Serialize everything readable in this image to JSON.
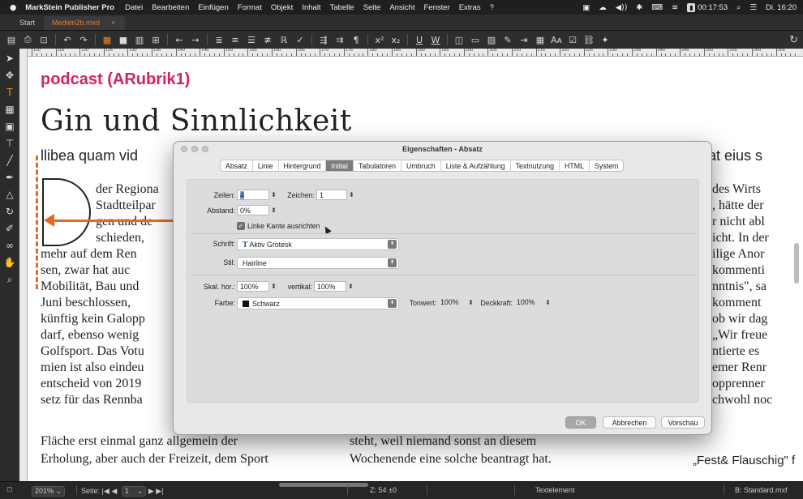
{
  "menubar": {
    "apple": "",
    "app_name": "MarkStein Publisher Pro",
    "items": [
      "Datei",
      "Bearbeiten",
      "Einfügen",
      "Format",
      "Objekt",
      "Inhalt",
      "Tabelle",
      "Seite",
      "Ansicht",
      "Fenster",
      "Extras",
      "?"
    ],
    "battery": "00:17:53",
    "datetime": "Di. 16:20"
  },
  "tabs": [
    {
      "label": "Start",
      "active": false
    },
    {
      "label": "Medien2b.mxd",
      "active": true,
      "close": "×"
    }
  ],
  "toolbar": {
    "icons": [
      "page-icon",
      "print-icon",
      "fit-icon",
      "undo-icon",
      "redo-icon",
      "frame-icon",
      "box-icon",
      "columns-icon",
      "grid-icon",
      "back-icon",
      "forward-icon",
      "align-left-icon",
      "align-center-icon",
      "align-right-icon",
      "justify-icon",
      "kerning-icon",
      "spellcheck-icon",
      "text-flow-icon",
      "text-wrap-icon",
      "paragraph-icon",
      "superscript-icon",
      "subscript-icon",
      "underline-icon",
      "word-underline-icon",
      "table-icon",
      "comment-icon",
      "image-icon",
      "style-icon",
      "tab-icon",
      "list-icon",
      "font-size-icon",
      "check-icon",
      "link-icon",
      "magic-icon"
    ],
    "superscript": "x²",
    "subscript": "x₂",
    "underline": "U",
    "word_underline": "W"
  },
  "ruler": {
    "labels": [
      "110",
      "115",
      "120",
      "125",
      "130",
      "135",
      "140",
      "145",
      "150",
      "155",
      "160",
      "165",
      "170",
      "175",
      "180",
      "185",
      "190",
      "195",
      "200",
      "205",
      "210",
      "215",
      "220",
      "225",
      "230",
      "235",
      "240",
      "245",
      "250",
      "255",
      "260",
      "265"
    ]
  },
  "document": {
    "rubrik": "podcast (ARubrik1)",
    "headline": "Gin und Sinnlichkeit",
    "lead_left": "llibea quam vid",
    "lead_right": "at eius s",
    "left_col": [
      "der Regiona",
      "Stadtteilpar",
      "gen und de",
      "schieden,",
      "mehr auf dem Ren",
      "sen, zwar hat auc",
      "Mobilität, Bau und",
      "Juni beschlossen,",
      "künftig kein Galopp",
      "darf, ebenso wenig",
      "Golfsport. Das Votu",
      "mien ist also eindeu",
      "entscheid von 2019",
      "setz für das Rennba",
      "Fläche erst einmal ganz allgemein der",
      "Erholung, aber auch der Freizeit, dem Sport"
    ],
    "mid_col": [
      "steht, weil niemand sonst an diesem",
      "Wochenende eine solche beantragt hat."
    ],
    "right_col": [
      "des Wirts",
      ", hätte der",
      "r nicht abl",
      "icht. In der",
      "ilige Anor",
      "kommenti",
      "nntnis\", sa",
      "komment",
      "ob wir dag",
      "„Wir freue",
      "ntierte es",
      "emer Renr",
      "opprenner",
      "chwohl noc",
      "",
      "„Fest& Flauschig\" f"
    ]
  },
  "dialog": {
    "title": "Eigenschaften - Absatz",
    "tabs": [
      "Absatz",
      "Linie",
      "Hintergrund",
      "Initial",
      "Tabulatoren",
      "Umbruch",
      "Liste & Aufzählung",
      "Textnutzung",
      "HTML",
      "System"
    ],
    "active_tab": "Initial",
    "zeilen_label": "Zeilen:",
    "zeilen_value": "4",
    "zeichen_label": "Zeichen:",
    "zeichen_value": "1",
    "abstand_label": "Abstand:",
    "abstand_value": "0%",
    "linke_kante_label": "Linke Kante ausrichten",
    "linke_kante_checked": true,
    "schrift_label": "Schrift:",
    "schrift_value": "Aktiv Grotesk",
    "stil_label": "Stil:",
    "stil_value": "Hairline",
    "skal_hor_label": "Skal. hor.:",
    "skal_hor_value": "100%",
    "vertikal_label": "vertikal:",
    "vertikal_value": "100%",
    "farbe_label": "Farbe:",
    "farbe_value": "Schwarz",
    "tonwert_label": "Tonwert:",
    "tonwert_value": "100%",
    "deckkraft_label": "Deckkraft:",
    "deckkraft_value": "100%",
    "ok_label": "OK",
    "cancel_label": "Abbrechen",
    "preview_label": "Vorschau"
  },
  "statusbar": {
    "zoom": "201%",
    "page_label": "Seite:",
    "page_value": "1",
    "z_label": "Z: 54 ±0",
    "element": "Textelement",
    "style": "B: Standard.mxf"
  },
  "colors": {
    "accent": "#e77a2b",
    "rubrik": "#d6245a",
    "guide": "#e56a1f"
  }
}
